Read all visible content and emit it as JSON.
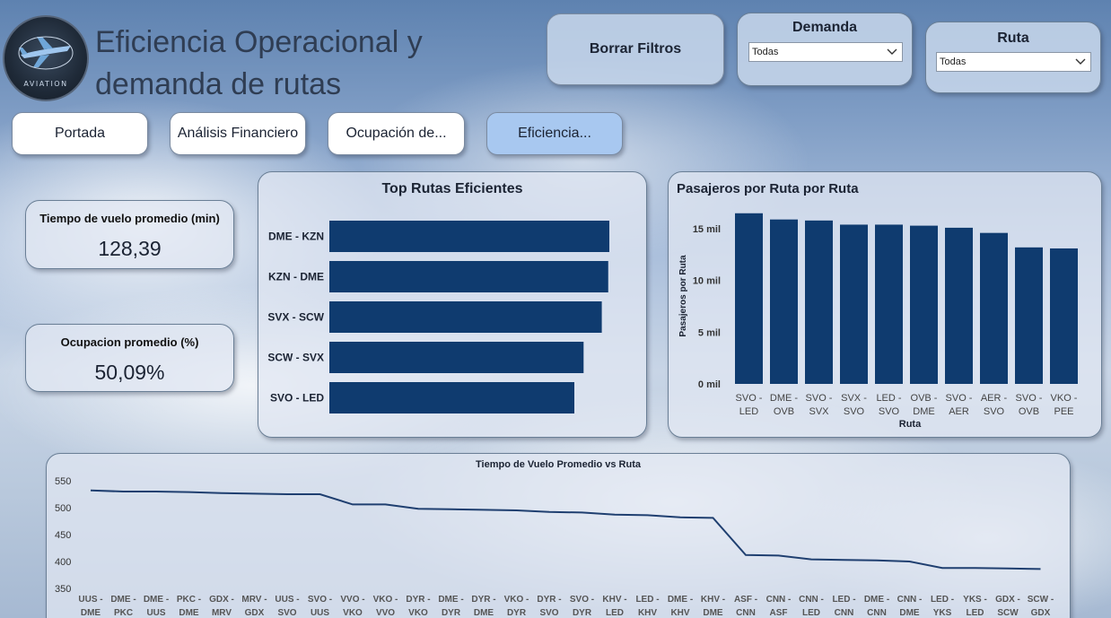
{
  "logo": {
    "text": "AVIATION"
  },
  "title": {
    "line1": "Eficiencia Operacional y",
    "line2": "demanda de rutas"
  },
  "nav": [
    {
      "label": "Portada",
      "active": false
    },
    {
      "label": "Análisis Financiero",
      "active": false
    },
    {
      "label": "Ocupación de...",
      "active": false
    },
    {
      "label": "Eficiencia...",
      "active": true
    }
  ],
  "filters": {
    "clear_label": "Borrar Filtros",
    "demanda": {
      "title": "Demanda",
      "value": "Todas"
    },
    "ruta": {
      "title": "Ruta",
      "value": "Todas"
    }
  },
  "kpis": {
    "tiempo": {
      "label": "Tiempo de vuelo promedio (min)",
      "value": "128,39"
    },
    "ocupacion": {
      "label": "Ocupacion promedio (%)",
      "value": "50,09%"
    }
  },
  "colors": {
    "bar": "#0f3b6f",
    "line": "#1f3f70",
    "active_nav": "#a8c8f0"
  },
  "chart_data": [
    {
      "type": "bar",
      "orientation": "horizontal",
      "title": "Top Rutas Eficientes",
      "categories": [
        "DME - KZN",
        "KZN - DME",
        "SVX - SCW",
        "SCW - SVX",
        "SVO - LED"
      ],
      "values": [
        100,
        99.6,
        97.3,
        90.8,
        87.5
      ]
    },
    {
      "type": "bar",
      "title": "Pasajeros por Ruta por Ruta",
      "xlabel": "Ruta",
      "ylabel": "Pasajeros por Ruta",
      "ylim": [
        0,
        17000
      ],
      "yticks": [
        0,
        5000,
        10000,
        15000
      ],
      "ytick_labels": [
        "0 mil",
        "5 mil",
        "10 mil",
        "15 mil"
      ],
      "categories": [
        [
          "SVO -",
          "LED"
        ],
        [
          "DME -",
          "OVB"
        ],
        [
          "SVO -",
          "SVX"
        ],
        [
          "SVX -",
          "SVO"
        ],
        [
          "LED -",
          "SVO"
        ],
        [
          "OVB -",
          "DME"
        ],
        [
          "SVO -",
          "AER"
        ],
        [
          "AER -",
          "SVO"
        ],
        [
          "SVO -",
          "OVB"
        ],
        [
          "VKO -",
          "PEE"
        ]
      ],
      "values": [
        16500,
        15900,
        15800,
        15400,
        15400,
        15300,
        15100,
        14600,
        13200,
        13100
      ]
    },
    {
      "type": "line",
      "title": "Tiempo de Vuelo Promedio vs Ruta",
      "ylim": [
        340,
        560
      ],
      "yticks": [
        350,
        400,
        450,
        500,
        550
      ],
      "categories": [
        [
          "UUS -",
          "DME"
        ],
        [
          "DME -",
          "PKC"
        ],
        [
          "DME -",
          "UUS"
        ],
        [
          "PKC -",
          "DME"
        ],
        [
          "GDX -",
          "MRV"
        ],
        [
          "MRV -",
          "GDX"
        ],
        [
          "UUS -",
          "SVO"
        ],
        [
          "SVO -",
          "UUS"
        ],
        [
          "VVO -",
          "VKO"
        ],
        [
          "VKO -",
          "VVO"
        ],
        [
          "DYR -",
          "VKO"
        ],
        [
          "DME -",
          "DYR"
        ],
        [
          "DYR -",
          "DME"
        ],
        [
          "VKO -",
          "DYR"
        ],
        [
          "DYR -",
          "SVO"
        ],
        [
          "SVO -",
          "DYR"
        ],
        [
          "KHV -",
          "LED"
        ],
        [
          "LED -",
          "KHV"
        ],
        [
          "DME -",
          "KHV"
        ],
        [
          "KHV -",
          "DME"
        ],
        [
          "ASF -",
          "CNN"
        ],
        [
          "CNN -",
          "ASF"
        ],
        [
          "CNN -",
          "LED"
        ],
        [
          "LED -",
          "CNN"
        ],
        [
          "DME -",
          "CNN"
        ],
        [
          "CNN -",
          "DME"
        ],
        [
          "LED -",
          "YKS"
        ],
        [
          "YKS -",
          "LED"
        ],
        [
          "GDX -",
          "SCW"
        ],
        [
          "SCW -",
          "GDX"
        ]
      ],
      "values": [
        532,
        530,
        530,
        529,
        527,
        526,
        525,
        525,
        506,
        506,
        498,
        497,
        496,
        495,
        492,
        491,
        487,
        486,
        482,
        481,
        412,
        411,
        404,
        403,
        402,
        400,
        388,
        388,
        387,
        386
      ]
    }
  ]
}
